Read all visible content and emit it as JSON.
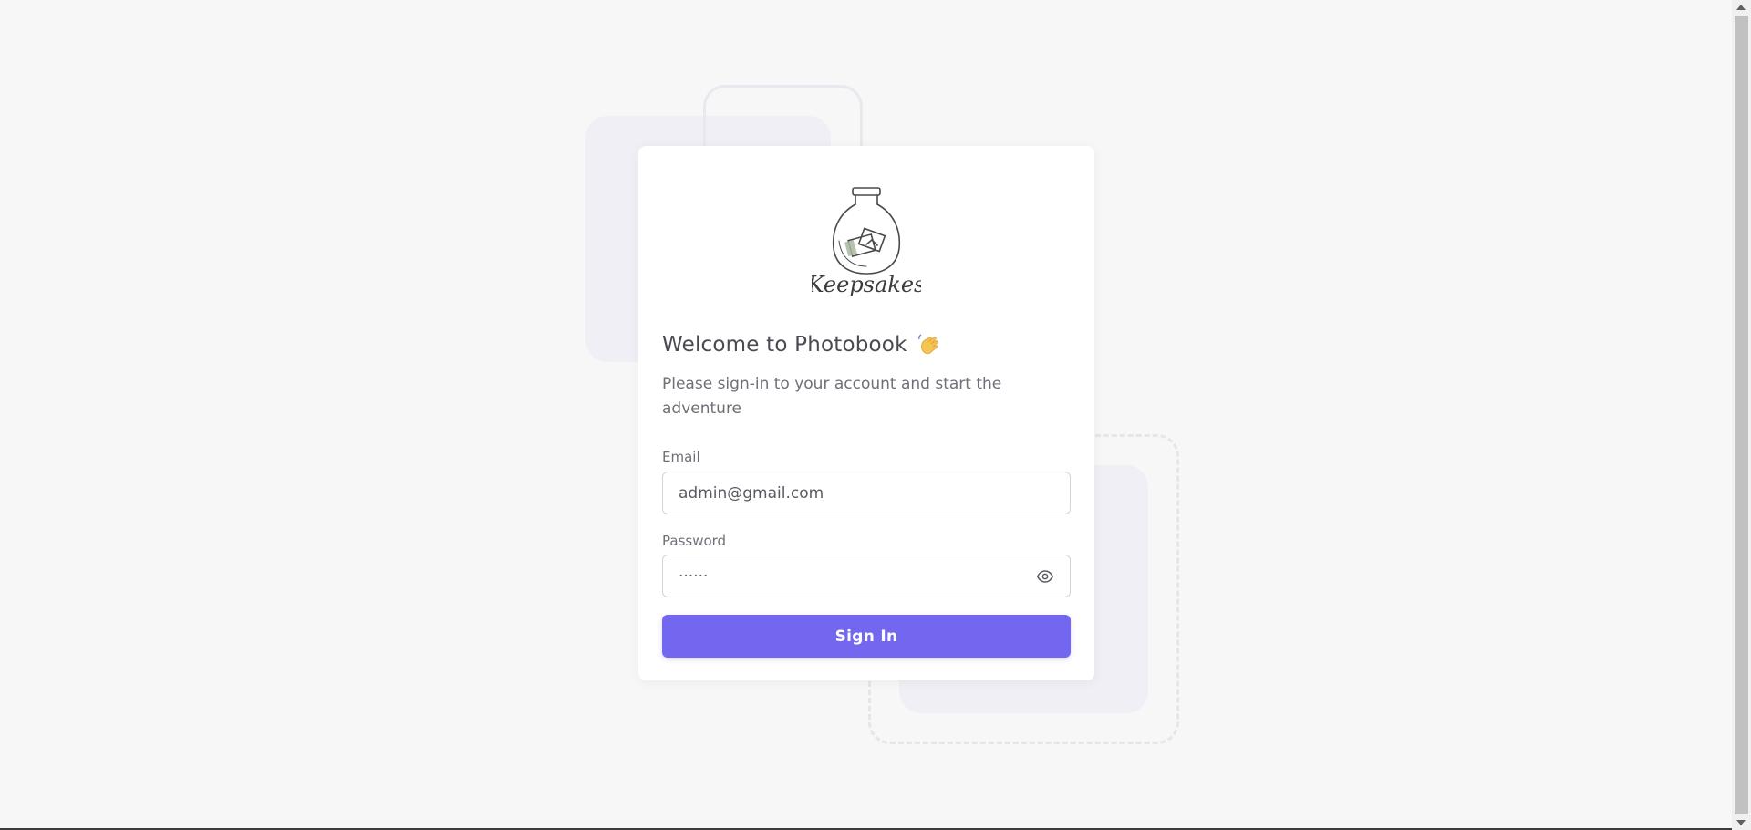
{
  "logo": {
    "text": "Keepsakes"
  },
  "welcome": {
    "title": "Welcome to Photobook",
    "emoji": "wave-icon",
    "subtitle": "Please sign-in to your account and start the adventure"
  },
  "form": {
    "email_label": "Email",
    "email_value": "admin@gmail.com",
    "password_label": "Password",
    "password_value": "······",
    "submit_label": "Sign In"
  },
  "colors": {
    "primary": "#7367f0",
    "background": "#f7f7f7",
    "card": "#ffffff"
  }
}
